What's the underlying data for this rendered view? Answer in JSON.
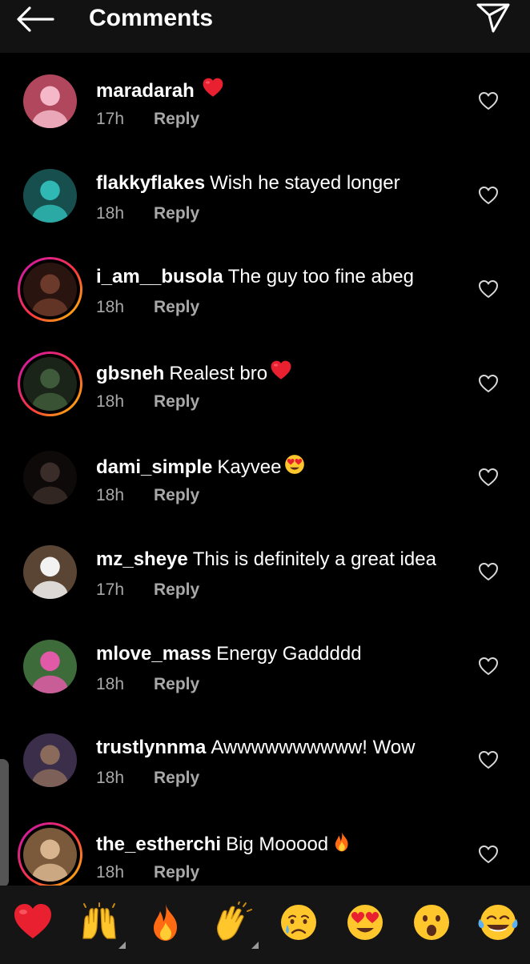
{
  "header": {
    "title": "Comments"
  },
  "comments": [
    {
      "username": "maradarah",
      "text": "",
      "time": "17h",
      "reply": "Reply",
      "trailing_emoji": "red-heart",
      "story_ring": false,
      "avatar_colors": [
        "#f4b8c8",
        "#b0475c"
      ]
    },
    {
      "username": "flakkyflakes",
      "text": "Wish he stayed longer",
      "time": "18h",
      "reply": "Reply",
      "trailing_emoji": "",
      "story_ring": false,
      "avatar_colors": [
        "#2fb8b4",
        "#174f4e"
      ]
    },
    {
      "username": "i_am__busola",
      "text": "The guy too fine abeg",
      "time": "18h",
      "reply": "Reply",
      "trailing_emoji": "",
      "story_ring": true,
      "avatar_colors": [
        "#6b3a2a",
        "#2a1410"
      ]
    },
    {
      "username": "gbsneh",
      "text": "Realest bro",
      "time": "18h",
      "reply": "Reply",
      "trailing_emoji": "red-heart",
      "story_ring": true,
      "avatar_colors": [
        "#3e5a3a",
        "#1b2419"
      ]
    },
    {
      "username": "dami_simple",
      "text": "Kayvee",
      "time": "18h",
      "reply": "Reply",
      "trailing_emoji": "heart-eyes",
      "story_ring": false,
      "avatar_colors": [
        "#3a2c28",
        "#0d0a09"
      ]
    },
    {
      "username": "mz_sheye",
      "text": "This is definitely a great idea",
      "time": "17h",
      "reply": "Reply",
      "trailing_emoji": "",
      "story_ring": false,
      "avatar_colors": [
        "#f2f2f2",
        "#5a4434"
      ]
    },
    {
      "username": "mlove_mass",
      "text": "Energy Gaddddd",
      "time": "18h",
      "reply": "Reply",
      "trailing_emoji": "",
      "story_ring": false,
      "avatar_colors": [
        "#e05aa8",
        "#3d6b3a"
      ]
    },
    {
      "username": "trustlynnma",
      "text": "Awwwwwwwwww! Wow",
      "time": "18h",
      "reply": "Reply",
      "trailing_emoji": "",
      "story_ring": false,
      "avatar_colors": [
        "#8a6a5a",
        "#3a2e4a"
      ]
    },
    {
      "username": "the_estherchi",
      "text": "Big Mooood",
      "time": "18h",
      "reply": "Reply",
      "trailing_emoji": "fire",
      "story_ring": true,
      "avatar_colors": [
        "#d9b58f",
        "#7a5a3a"
      ]
    }
  ],
  "emoji_bar": [
    {
      "name": "red-heart",
      "variants": false
    },
    {
      "name": "raising-hands",
      "variants": true
    },
    {
      "name": "fire",
      "variants": false
    },
    {
      "name": "clapping-hands",
      "variants": true
    },
    {
      "name": "crying-face",
      "variants": false
    },
    {
      "name": "heart-eyes",
      "variants": false
    },
    {
      "name": "surprised-face",
      "variants": false
    },
    {
      "name": "tears-of-joy",
      "variants": false
    }
  ],
  "colors": {
    "background": "#000000",
    "header_background": "#121212",
    "secondary_text": "#a8a8a8",
    "heart_red": "#e8202f",
    "emoji_yellow": "#ffc72c"
  }
}
